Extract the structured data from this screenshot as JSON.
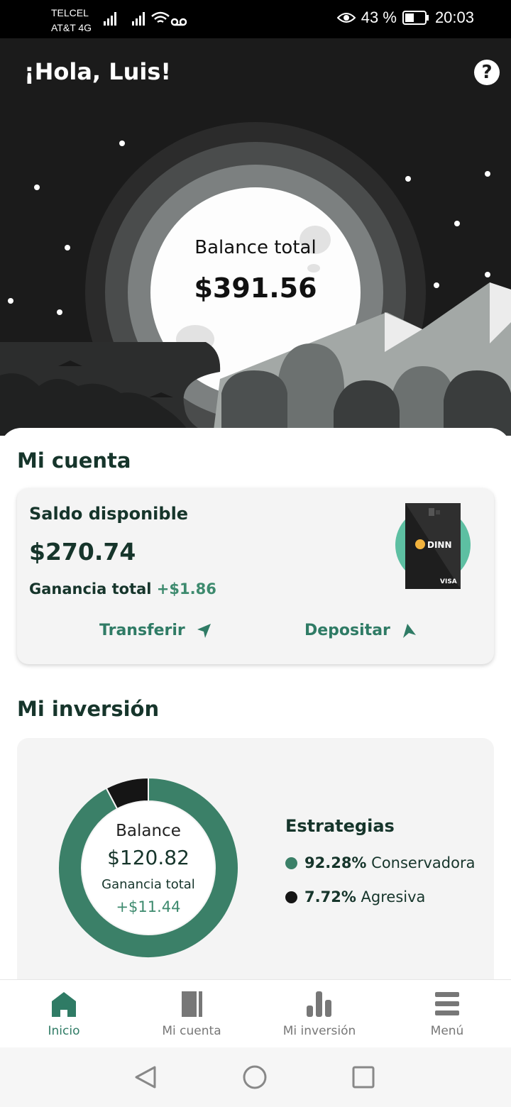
{
  "status_bar": {
    "carrier_1": "TELCEL",
    "carrier_2": "AT&T 4G",
    "battery": "43 %",
    "time": "20:03"
  },
  "header": {
    "greeting": "¡Hola, Luis!",
    "help": "?"
  },
  "hero": {
    "balance_label": "Balance total",
    "balance_value": "$391.56"
  },
  "account": {
    "section_title": "Mi cuenta",
    "available_label": "Saldo disponible",
    "available_amount": "$270.74",
    "total_gain_label": "Ganancia total",
    "total_gain_value": "+$1.86",
    "transfer_label": "Transferir",
    "deposit_label": "Depositar",
    "card_brand": "DINN",
    "card_network": "VISA"
  },
  "investment": {
    "section_title": "Mi inversión",
    "balance_label": "Balance",
    "balance_value": "$120.82",
    "gain_label": "Ganancia total",
    "gain_value": "+$11.44",
    "strategies_title": "Estrategias",
    "strategies": [
      {
        "percent": "92.28%",
        "name": "Conservadora",
        "color": "#3b8068",
        "fraction": 0.9228
      },
      {
        "percent": "7.72%",
        "name": "Agresiva",
        "color": "#151515",
        "fraction": 0.0772
      }
    ]
  },
  "bottom_nav": [
    {
      "label": "Inicio",
      "icon": "home-icon",
      "active": true
    },
    {
      "label": "Mi cuenta",
      "icon": "book-icon",
      "active": false
    },
    {
      "label": "Mi inversión",
      "icon": "bar-chart-icon",
      "active": false
    },
    {
      "label": "Menú",
      "icon": "menu-icon",
      "active": false
    }
  ],
  "colors": {
    "accent": "#2f7b65",
    "gain_green": "#3d8a6e",
    "dark_text": "#16352b",
    "hero_bg": "#1b1b1b"
  }
}
